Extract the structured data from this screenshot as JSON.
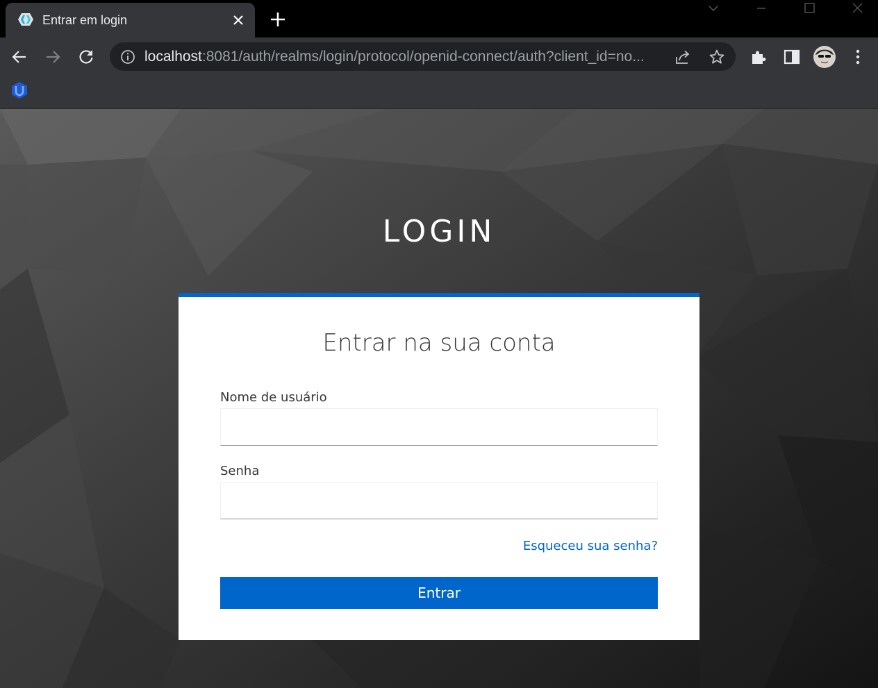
{
  "browser": {
    "tab": {
      "title": "Entrar em login",
      "favicon": "keycloak-icon"
    },
    "new_tab_icon": "plus-icon",
    "window_controls": [
      "chevron-down-icon",
      "minimize-icon",
      "maximize-icon",
      "close-icon"
    ],
    "nav": {
      "back_icon": "arrow-left-icon",
      "forward_icon": "arrow-right-icon",
      "reload_icon": "reload-icon"
    },
    "omnibox": {
      "info_icon": "info-icon",
      "url_host": "localhost",
      "url_rest": ":8081/auth/realms/login/protocol/openid-connect/auth?client_id=no...",
      "share_icon": "share-icon",
      "bookmark_icon": "star-icon"
    },
    "toolbar_icons": [
      "puzzle-icon",
      "side-panel-icon",
      "avatar",
      "kebab-menu-icon"
    ],
    "bookmarks": [
      {
        "icon": "bookmark-app-icon"
      }
    ]
  },
  "page": {
    "heading": "LOGIN",
    "card": {
      "title": "Entrar na sua conta",
      "username_label": "Nome de usuário",
      "username_value": "",
      "password_label": "Senha",
      "password_value": "",
      "forgot_link": "Esqueceu sua senha?",
      "submit_label": "Entrar"
    }
  },
  "colors": {
    "accent": "#0066cc",
    "chrome_dark": "#000000",
    "chrome_toolbar": "#35363a"
  }
}
